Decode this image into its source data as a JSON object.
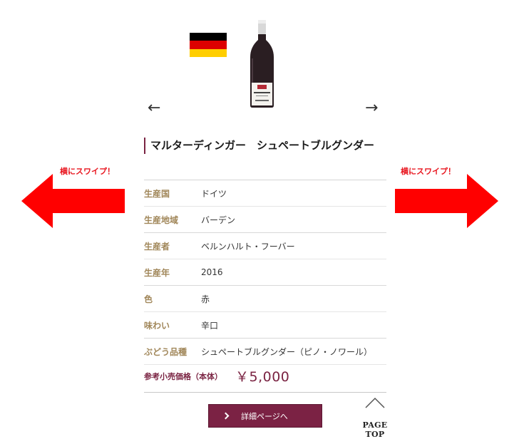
{
  "product": {
    "title": "マルターディンガー　シュペートブルグンダー",
    "flag_colors": [
      "#000000",
      "#dd0000",
      "#ffce00"
    ],
    "accent_color": "#7a2342"
  },
  "navigation": {
    "prev_arrow": "←",
    "next_arrow": "→"
  },
  "swipe_hint": {
    "left_label": "横にスワイプ！",
    "right_label": "横にスワイプ！",
    "arrow_color": "#ff0000"
  },
  "specs": [
    {
      "label": "生産国",
      "value": "ドイツ"
    },
    {
      "label": "生産地域",
      "value": "バーデン"
    },
    {
      "label": "生産者",
      "value": "ベルンハルト・フーバー"
    },
    {
      "label": "生産年",
      "value": "2016"
    },
    {
      "label": "色",
      "value": "赤"
    },
    {
      "label": "味わい",
      "value": "辛口"
    },
    {
      "label": "ぶどう品種",
      "value": "シュペートブルグンダー（ピノ・ノワール）"
    }
  ],
  "price": {
    "label": "参考小売価格（本体）",
    "value": "￥5,000"
  },
  "detail_button": {
    "label": "詳細ページへ"
  },
  "page_top": {
    "label": "PAGE TOP"
  }
}
